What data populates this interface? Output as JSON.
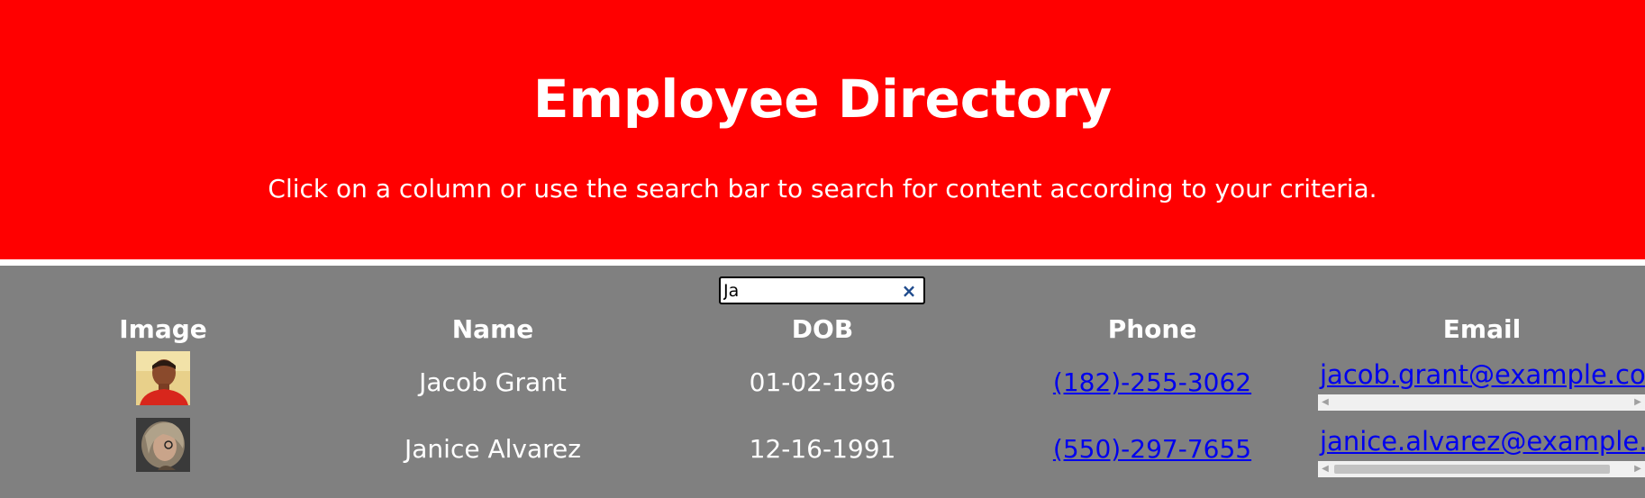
{
  "header": {
    "title": "Employee Directory",
    "subtitle": "Click on a column or use the search bar to search for content according to your criteria."
  },
  "search": {
    "value": "Ja",
    "clear_icon": "close-icon"
  },
  "table": {
    "columns": [
      "Image",
      "Name",
      "DOB",
      "Phone",
      "Email"
    ],
    "rows": [
      {
        "image": "avatar-photo",
        "name": "Jacob Grant",
        "dob": "01-02-1996",
        "phone": "(182)-255-3062",
        "email": "jacob.grant@example.com",
        "email_scroll": 0.0
      },
      {
        "image": "avatar-photo",
        "name": "Janice Alvarez",
        "dob": "12-16-1991",
        "phone": "(550)-297-7655",
        "email": "janice.alvarez@example.com",
        "email_scroll": 0.0
      }
    ]
  },
  "colors": {
    "header_bg": "#ff0000",
    "body_bg": "#808080",
    "link": "#0000ee"
  }
}
